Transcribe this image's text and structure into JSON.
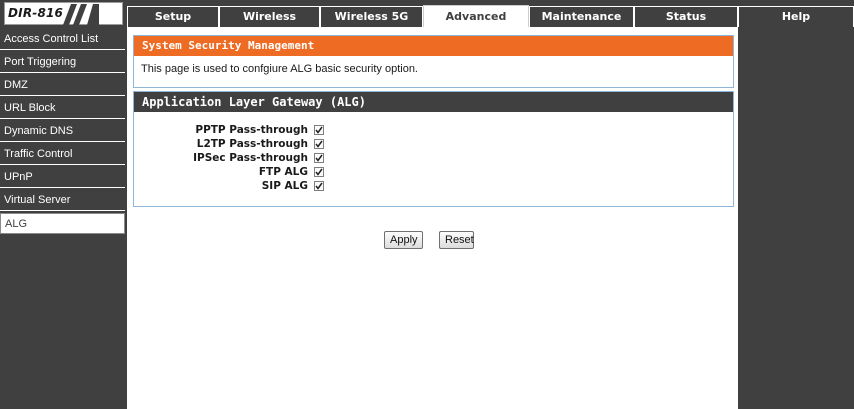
{
  "header": {
    "model": "DIR-816",
    "tabs": [
      {
        "label": "Setup",
        "active": false
      },
      {
        "label": "Wireless",
        "active": false
      },
      {
        "label": "Wireless 5G",
        "active": false
      },
      {
        "label": "Advanced",
        "active": true
      },
      {
        "label": "Maintenance",
        "active": false
      },
      {
        "label": "Status",
        "active": false
      },
      {
        "label": "Help",
        "active": false
      }
    ]
  },
  "sidebar": {
    "items": [
      {
        "label": "Access Control List",
        "active": false
      },
      {
        "label": "Port Triggering",
        "active": false
      },
      {
        "label": "DMZ",
        "active": false
      },
      {
        "label": "URL Block",
        "active": false
      },
      {
        "label": "Dynamic DNS",
        "active": false
      },
      {
        "label": "Traffic Control",
        "active": false
      },
      {
        "label": "UPnP",
        "active": false
      },
      {
        "label": "Virtual Server",
        "active": false
      },
      {
        "label": "ALG",
        "active": true
      }
    ]
  },
  "security_panel": {
    "title": "System Security Management",
    "description": "This page is used to confgiure ALG basic security option."
  },
  "alg_panel": {
    "title": "Application Layer Gateway (ALG)",
    "options": [
      {
        "label": "PPTP Pass-through",
        "checked": true
      },
      {
        "label": "L2TP Pass-through",
        "checked": true
      },
      {
        "label": "IPSec Pass-through",
        "checked": true
      },
      {
        "label": "FTP ALG",
        "checked": true
      },
      {
        "label": "SIP ALG",
        "checked": true
      }
    ]
  },
  "actions": {
    "apply_label": "Apply",
    "reset_label": "Reset"
  },
  "colors": {
    "bar_dark": "#404040",
    "header_orange": "#ee6b23",
    "panel_border": "#8fb6d9"
  }
}
